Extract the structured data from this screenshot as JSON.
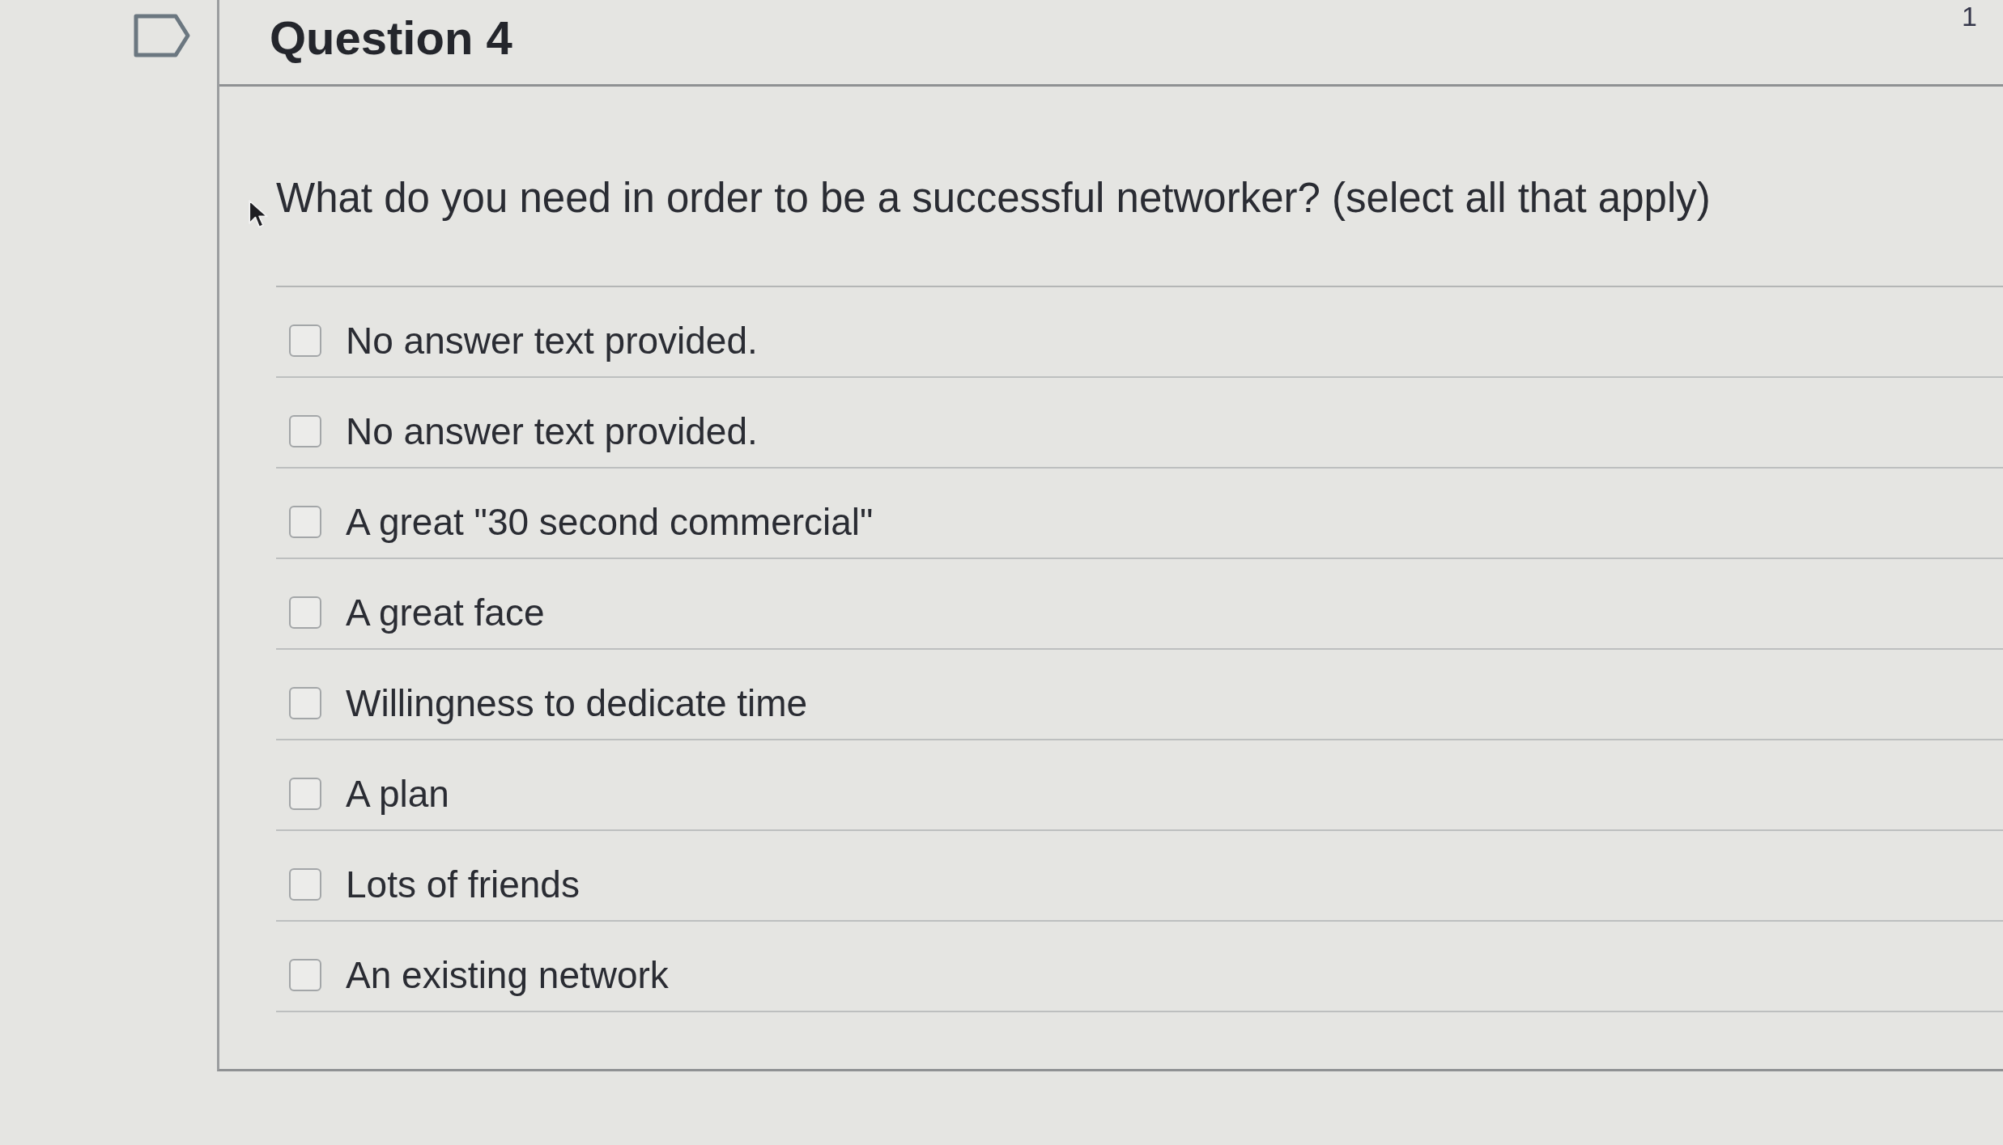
{
  "sidebar": {
    "flag_button": {
      "flagged": false
    }
  },
  "question": {
    "title": "Question 4",
    "points": "1",
    "text": "What do you need in order to be a successful networker? (select all that apply)",
    "answers": [
      {
        "label": "No answer text provided.",
        "checked": false
      },
      {
        "label": "No answer text provided.",
        "checked": false
      },
      {
        "label": "A great \"30 second commercial\"",
        "checked": false
      },
      {
        "label": "A great face",
        "checked": false
      },
      {
        "label": "Willingness to dedicate time",
        "checked": false
      },
      {
        "label": "A plan",
        "checked": false
      },
      {
        "label": "Lots of friends",
        "checked": false
      },
      {
        "label": "An existing network",
        "checked": false
      }
    ]
  }
}
